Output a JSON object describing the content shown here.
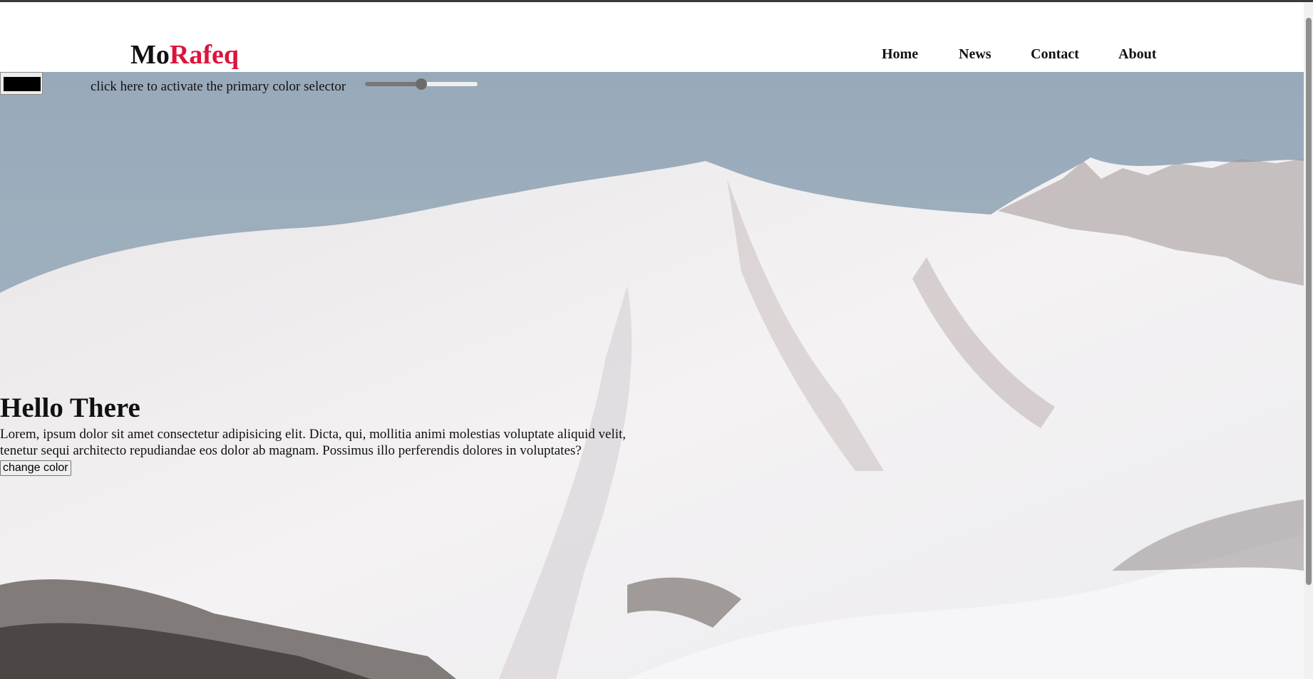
{
  "logo": {
    "part1": "Mo",
    "part2": "Rafeq"
  },
  "nav": [
    {
      "label": "Home"
    },
    {
      "label": "News"
    },
    {
      "label": "Contact"
    },
    {
      "label": "About"
    }
  ],
  "color_picker": {
    "value": "#000000",
    "label": "click here to activate the primary color selector"
  },
  "slider": {
    "value": 0.5
  },
  "hero": {
    "title": "Hello There",
    "text": "Lorem, ipsum dolor sit amet consectetur adipisicing elit. Dicta, qui, mollitia animi molestias voluptate aliquid velit, tenetur sequi architecto repudiandae eos dolor ab magnam. Possimus illo perferendis dolores in voluptates?",
    "button_label": "change color"
  },
  "colors": {
    "accent": "#dc143c",
    "sky": "#9aabba",
    "snow": "#f1eff0"
  }
}
